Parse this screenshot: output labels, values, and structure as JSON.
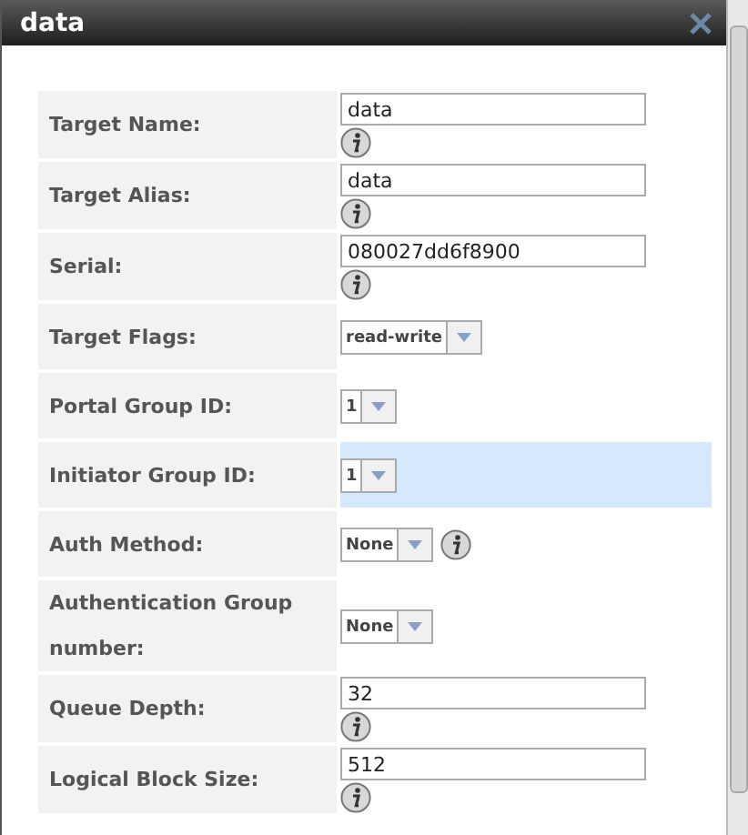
{
  "window": {
    "title": "data"
  },
  "rows": [
    {
      "label": "Target Name:",
      "kind": "text",
      "value": "data",
      "info": true,
      "highlighted": false
    },
    {
      "label": "Target Alias:",
      "kind": "text",
      "value": "data",
      "info": true,
      "highlighted": false
    },
    {
      "label": "Serial:",
      "kind": "text",
      "value": "080027dd6f8900",
      "info": true,
      "highlighted": false
    },
    {
      "label": "Target Flags:",
      "kind": "select",
      "value": "read-write",
      "info": false,
      "highlighted": false
    },
    {
      "label": "Portal Group ID:",
      "kind": "select",
      "value": "1",
      "info": false,
      "highlighted": false
    },
    {
      "label": "Initiator Group ID:",
      "kind": "select",
      "value": "1",
      "info": false,
      "highlighted": true
    },
    {
      "label": "Auth Method:",
      "kind": "select",
      "value": "None",
      "info": true,
      "highlighted": false
    },
    {
      "label": "Authentication Group number:",
      "kind": "select",
      "value": "None",
      "info": false,
      "highlighted": false
    },
    {
      "label": "Queue Depth:",
      "kind": "text",
      "value": "32",
      "info": true,
      "highlighted": false
    },
    {
      "label": "Logical Block Size:",
      "kind": "text",
      "value": "512",
      "info": true,
      "highlighted": false
    }
  ]
}
